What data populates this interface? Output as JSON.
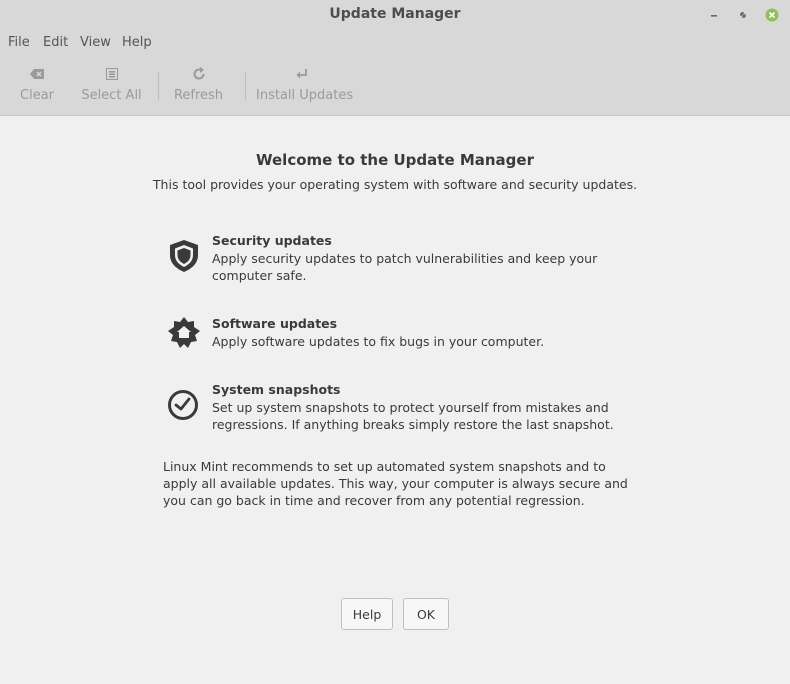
{
  "window": {
    "title": "Update Manager",
    "controls": [
      "minimize-icon",
      "maximize-icon",
      "close-icon"
    ],
    "close_color": "#8fbf5c"
  },
  "menu": {
    "items": [
      "File",
      "Edit",
      "View",
      "Help"
    ]
  },
  "toolbar": {
    "clear_label": "Clear",
    "select_all_label": "Select All",
    "refresh_label": "Refresh",
    "install_label": "Install Updates"
  },
  "welcome": {
    "title": "Welcome to the Update Manager",
    "subtitle": "This tool provides your operating system with software and security updates.",
    "features": [
      {
        "icon": "shield-icon",
        "title": "Security updates",
        "description": "Apply security updates to patch vulnerabilities and keep your computer safe."
      },
      {
        "icon": "gear-home-icon",
        "title": "Software updates",
        "description": "Apply software updates to fix bugs in your computer."
      },
      {
        "icon": "clock-icon",
        "title": "System snapshots",
        "description": "Set up system snapshots to protect yourself from mistakes and regressions. If anything breaks simply restore the last snapshot."
      }
    ],
    "recommendation": "Linux Mint recommends to set up automated system snapshots and to apply all available updates. This way, your computer is always secure and you can go back in time and recover from any potential regression."
  },
  "buttons": {
    "help_label": "Help",
    "ok_label": "OK"
  }
}
